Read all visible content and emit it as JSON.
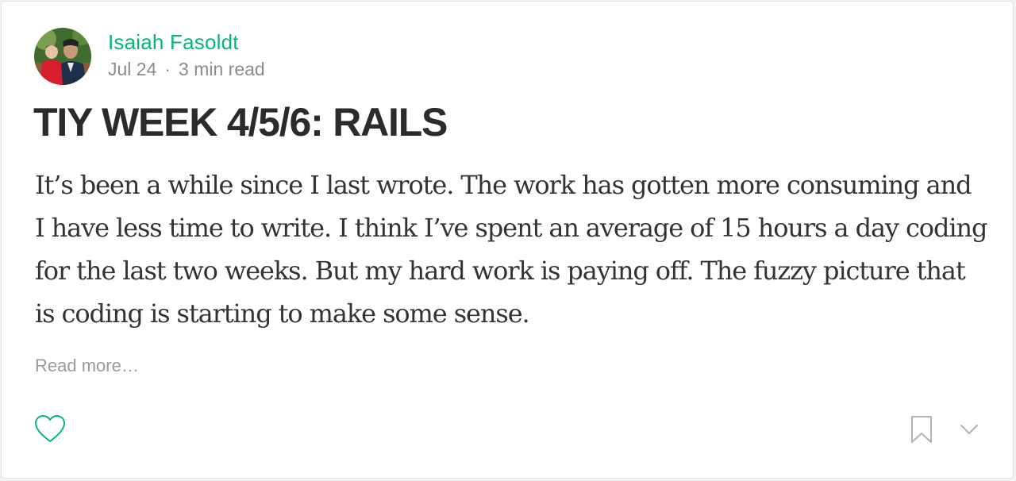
{
  "post": {
    "author": "Isaiah Fasoldt",
    "date": "Jul 24",
    "separator": "·",
    "read_time": "3 min read",
    "title": "TIY WEEK 4/5/6: RAILS",
    "excerpt": "It’s been a while since I last wrote. The work has gotten more consuming and I have less time to write. I think I’ve spent an average of 15 hours a day coding for the last two weeks. But my hard work is paying off. The fuzzy picture that is coding is starting to make some sense.",
    "read_more": "Read more…"
  },
  "actions": {
    "like_icon": "heart-icon",
    "bookmark_icon": "bookmark-icon",
    "more_icon": "chevron-down-icon"
  },
  "colors": {
    "accent": "#02b875",
    "meta": "#8c8c8c",
    "icon_gray": "#b3b3b3"
  }
}
